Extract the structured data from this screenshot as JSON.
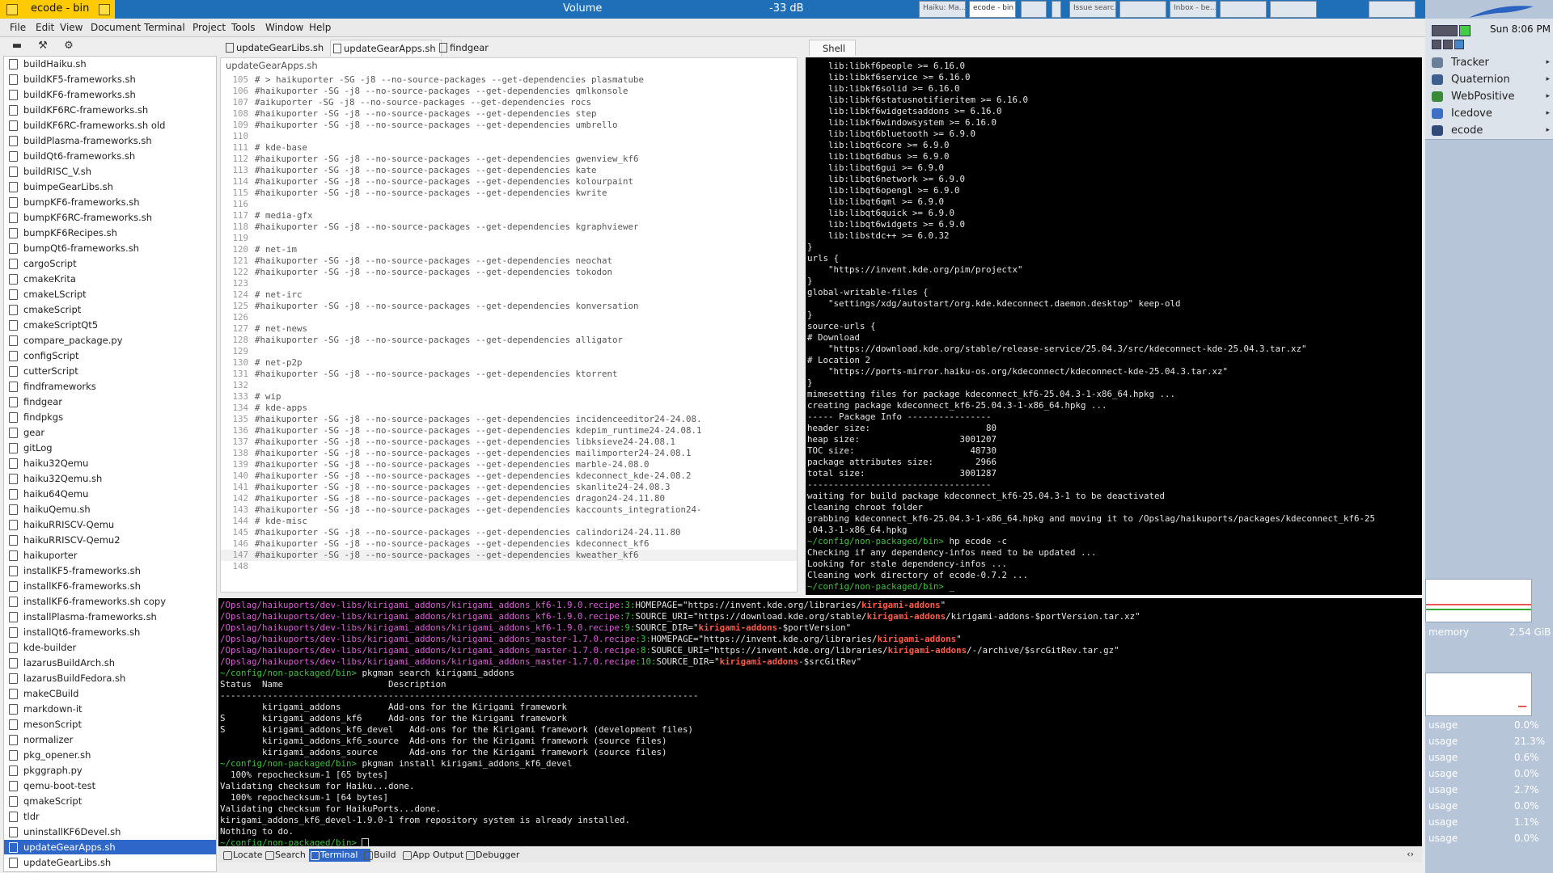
{
  "window": {
    "title": "ecode - bin"
  },
  "topbar": {
    "volume_label": "Volume",
    "volume_db": "-33 dB",
    "tasks": [
      "Haiku: Ma...",
      "ecode - bin",
      "",
      "",
      "Issue searc...",
      "",
      "Inbox - be...",
      "",
      "",
      ""
    ]
  },
  "menu": [
    "File",
    "Edit",
    "View",
    "Document",
    "Terminal",
    "Project",
    "Tools",
    "Window",
    "Help"
  ],
  "toolbar_icons": [
    "folder-icon",
    "wrench-icon",
    "gear-icon"
  ],
  "files": [
    "buildHaiku.sh",
    "buildKF5-frameworks.sh",
    "buildKF6-frameworks.sh",
    "buildKF6RC-frameworks.sh",
    "buildKF6RC-frameworks.sh old",
    "buildPlasma-frameworks.sh",
    "buildQt6-frameworks.sh",
    "buildRISC_V.sh",
    "buimpeGearLibs.sh",
    "bumpKF6-frameworks.sh",
    "bumpKF6RC-frameworks.sh",
    "bumpKF6Recipes.sh",
    "bumpQt6-frameworks.sh",
    "cargoScript",
    "cmakeKrita",
    "cmakeLScript",
    "cmakeScript",
    "cmakeScriptQt5",
    "compare_package.py",
    "configScript",
    "cutterScript",
    "findframeworks",
    "findgear",
    "findpkgs",
    "gear",
    "gitLog",
    "haiku32Qemu",
    "haiku32Qemu.sh",
    "haiku64Qemu",
    "haikuQemu.sh",
    "haikuRRISCV-Qemu",
    "haikuRRISCV-Qemu2",
    "haikuporter",
    "installKF5-frameworks.sh",
    "installKF6-frameworks.sh",
    "installKF6-frameworks.sh copy",
    "installPlasma-frameworks.sh",
    "installQt6-frameworks.sh",
    "kde-builder",
    "lazarusBuildArch.sh",
    "lazarusBuildFedora.sh",
    "makeCBuild",
    "markdown-it",
    "mesonScript",
    "normalizer",
    "pkg_opener.sh",
    "pkggraph.py",
    "qemu-boot-test",
    "qmakeScript",
    "tldr",
    "uninstallKF6Devel.sh",
    "updateGearApps.sh",
    "updateGearLibs.sh"
  ],
  "selected_file": "updateGearApps.sh",
  "editor": {
    "tabs": [
      "updateGearLibs.sh",
      "updateGearApps.sh",
      "findgear"
    ],
    "breadcrumb": "updateGearApps.sh",
    "lines": [
      [
        "105",
        "# > haikuporter -SG -j8 --no-source-packages --get-dependencies plasmatube"
      ],
      [
        "106",
        "#haikuporter -SG -j8 --no-source-packages --get-dependencies qmlkonsole"
      ],
      [
        "107",
        "#aikuporter -SG -j8 --no-source-packages --get-dependencies rocs"
      ],
      [
        "108",
        "#haikuporter -SG -j8 --no-source-packages --get-dependencies step"
      ],
      [
        "109",
        "#haikuporter -SG -j8 --no-source-packages --get-dependencies umbrello"
      ],
      [
        "110",
        ""
      ],
      [
        "111",
        "# kde-base"
      ],
      [
        "112",
        "#haikuporter -SG -j8 --no-source-packages --get-dependencies gwenview_kf6"
      ],
      [
        "113",
        "#haikuporter -SG -j8 --no-source-packages --get-dependencies kate"
      ],
      [
        "114",
        "#haikuporter -SG -j8 --no-source-packages --get-dependencies kolourpaint"
      ],
      [
        "115",
        "#haikuporter -SG -j8 --no-source-packages --get-dependencies kwrite"
      ],
      [
        "116",
        ""
      ],
      [
        "117",
        "# media-gfx"
      ],
      [
        "118",
        "#haikuporter -SG -j8 --no-source-packages --get-dependencies kgraphviewer"
      ],
      [
        "119",
        ""
      ],
      [
        "120",
        "# net-im"
      ],
      [
        "121",
        "#haikuporter -SG -j8 --no-source-packages --get-dependencies neochat"
      ],
      [
        "122",
        "#haikuporter -SG -j8 --no-source-packages --get-dependencies tokodon"
      ],
      [
        "123",
        ""
      ],
      [
        "124",
        "# net-irc"
      ],
      [
        "125",
        "#haikuporter -SG -j8 --no-source-packages --get-dependencies konversation"
      ],
      [
        "126",
        ""
      ],
      [
        "127",
        "# net-news"
      ],
      [
        "128",
        "#haikuporter -SG -j8 --no-source-packages --get-dependencies alligator"
      ],
      [
        "129",
        ""
      ],
      [
        "130",
        "# net-p2p"
      ],
      [
        "131",
        "#haikuporter -SG -j8 --no-source-packages --get-dependencies ktorrent"
      ],
      [
        "132",
        ""
      ],
      [
        "133",
        "# wip"
      ],
      [
        "134",
        "# kde-apps"
      ],
      [
        "135",
        "#haikuporter -SG -j8 --no-source-packages --get-dependencies incidenceeditor24-24.08."
      ],
      [
        "136",
        "#haikuporter -SG -j8 --no-source-packages --get-dependencies kdepim_runtime24-24.08.1"
      ],
      [
        "137",
        "#haikuporter -SG -j8 --no-source-packages --get-dependencies libksieve24-24.08.1"
      ],
      [
        "138",
        "#haikuporter -SG -j8 --no-source-packages --get-dependencies mailimporter24-24.08.1"
      ],
      [
        "139",
        "#haikuporter -SG -j8 --no-source-packages --get-dependencies marble-24.08.0"
      ],
      [
        "140",
        "#haikuporter -SG -j8 --no-source-packages --get-dependencies kdeconnect_kde-24.08.2"
      ],
      [
        "141",
        "#haikuporter -SG -j8 --no-source-packages --get-dependencies skanlite24-24.08.3"
      ],
      [
        "142",
        "#haikuporter -SG -j8 --no-source-packages --get-dependencies dragon24-24.11.80"
      ],
      [
        "143",
        "#haikuporter -SG -j8 --no-source-packages --get-dependencies kaccounts_integration24-"
      ],
      [
        "144",
        "# kde-misc"
      ],
      [
        "145",
        "#haikuporter -SG -j8 --no-source-packages --get-dependencies calindori24-24.11.80"
      ],
      [
        "146",
        "#haikuporter -SG -j8 --no-source-packages --get-dependencies kdeconnect_kf6"
      ],
      [
        "147",
        "#haikuporter -SG -j8 --no-source-packages --get-dependencies kweather_kf6"
      ],
      [
        "148",
        ""
      ]
    ]
  },
  "shell": {
    "tab": "Shell",
    "lines": [
      "    lib:libkf6people >= 6.16.0",
      "    lib:libkf6service >= 6.16.0",
      "    lib:libkf6solid >= 6.16.0",
      "    lib:libkf6statusnotifieritem >= 6.16.0",
      "    lib:libkf6widgetsaddons >= 6.16.0",
      "    lib:libkf6windowsystem >= 6.16.0",
      "    lib:libqt6bluetooth >= 6.9.0",
      "    lib:libqt6core >= 6.9.0",
      "    lib:libqt6dbus >= 6.9.0",
      "    lib:libqt6gui >= 6.9.0",
      "    lib:libqt6network >= 6.9.0",
      "    lib:libqt6opengl >= 6.9.0",
      "    lib:libqt6qml >= 6.9.0",
      "    lib:libqt6quick >= 6.9.0",
      "    lib:libqt6widgets >= 6.9.0",
      "    lib:libstdc++ >= 6.0.32",
      "}",
      "urls {",
      "    \"https://invent.kde.org/pim/projectx\"",
      "}",
      "global-writable-files {",
      "    \"settings/xdg/autostart/org.kde.kdeconnect.daemon.desktop\" keep-old",
      "}",
      "source-urls {",
      "# Download",
      "    \"https://download.kde.org/stable/release-service/25.04.3/src/kdeconnect-kde-25.04.3.tar.xz\"",
      "# Location 2",
      "    \"https://ports-mirror.haiku-os.org/kdeconnect/kdeconnect-kde-25.04.3.tar.xz\"",
      "}",
      "mimesetting files for package kdeconnect_kf6-25.04.3-1-x86_64.hpkg ...",
      "creating package kdeconnect_kf6-25.04.3-1-x86_64.hpkg ...",
      "----- Package Info ----------------",
      "header size:                      80",
      "heap size:                   3001207",
      "TOC size:                      48730",
      "package attributes size:        2966",
      "total size:                  3001287",
      "-----------------------------------",
      "waiting for build package kdeconnect_kf6-25.04.3-1 to be deactivated",
      "cleaning chroot folder",
      "grabbing kdeconnect_kf6-25.04.3-1-x86_64.hpkg and moving it to /Opslag/haikuports/packages/kdeconnect_kf6-25",
      ".04.3-1-x86_64.hpkg"
    ],
    "prompt1": "~/config/non-packaged/bin>",
    "cmd1": " hp ecode -c",
    "after": [
      "Checking if any dependency-infos need to be updated ...",
      "Looking for stale dependency-infos ...",
      "Cleaning work directory of ecode-0.7.2 ..."
    ],
    "prompt2": "~/config/non-packaged/bin>",
    "cursor": " _"
  },
  "terminal": {
    "grep": [
      {
        "path": "/Opslag/haikuports/dev-libs/kirigami_addons/kirigami_addons_kf6-1.9.0.recipe",
        "ln": ":3:",
        "pre": "HOMEPAGE=\"https://invent.kde.org/libraries/",
        "hit": "kirigami-addons",
        "post": "\""
      },
      {
        "path": "/Opslag/haikuports/dev-libs/kirigami_addons/kirigami_addons_kf6-1.9.0.recipe",
        "ln": ":7:",
        "pre": "SOURCE_URI=\"https://download.kde.org/stable/",
        "hit": "kirigami-addons",
        "post": "/kirigami-addons-$portVersion.tar.xz\""
      },
      {
        "path": "/Opslag/haikuports/dev-libs/kirigami_addons/kirigami_addons_kf6-1.9.0.recipe",
        "ln": ":9:",
        "pre": "SOURCE_DIR=\"",
        "hit": "kirigami-addons",
        "post": "-$portVersion\""
      },
      {
        "path": "/Opslag/haikuports/dev-libs/kirigami_addons/kirigami_addons_master-1.7.0.recipe",
        "ln": ":3:",
        "pre": "HOMEPAGE=\"https://invent.kde.org/libraries/",
        "hit": "kirigami-addons",
        "post": "\""
      },
      {
        "path": "/Opslag/haikuports/dev-libs/kirigami_addons/kirigami_addons_master-1.7.0.recipe",
        "ln": ":8:",
        "pre": "SOURCE_URI=\"https://invent.kde.org/libraries/",
        "hit": "kirigami-addons",
        "post": "/-/archive/$srcGitRev.tar.gz\""
      },
      {
        "path": "/Opslag/haikuports/dev-libs/kirigami_addons/kirigami_addons_master-1.7.0.recipe",
        "ln": ":10:",
        "pre": "SOURCE_DIR=\"",
        "hit": "kirigami-addons",
        "post": "-$srcGitRev\""
      }
    ],
    "prompt": "~/config/non-packaged/bin>",
    "cmd_search": " pkgman search kirigami_addons",
    "header": "Status  Name                    Description",
    "divider": "-------------------------------------------------------------------------------------------",
    "rows": [
      "        kirigami_addons         Add-ons for the Kirigami framework",
      "S       kirigami_addons_kf6     Add-ons for the Kirigami framework",
      "S       kirigami_addons_kf6_devel   Add-ons for the Kirigami framework (development files)",
      "        kirigami_addons_kf6_source  Add-ons for the Kirigami framework (source files)",
      "        kirigami_addons_source      Add-ons for the Kirigami framework (source files)"
    ],
    "cmd_install": " pkgman install kirigami_addons_kf6_devel",
    "install_out": [
      "  100% repochecksum-1 [65 bytes]",
      "Validating checksum for Haiku...done.",
      "  100% repochecksum-1 [64 bytes]",
      "Validating checksum for HaikuPorts...done.",
      "kirigami_addons_kf6_devel-1.9.0-1 from repository system is already installed.",
      "Nothing to do."
    ]
  },
  "bottom_tabs": [
    "Locate",
    "Search",
    "Terminal",
    "Build",
    "App Output",
    "Debugger"
  ],
  "deskbar": {
    "clock": "Sun 8:06 PM",
    "items": [
      {
        "label": "Tracker",
        "color": "#6a7f99"
      },
      {
        "label": "Quaternion",
        "color": "#3d5f8f"
      },
      {
        "label": "WebPositive",
        "color": "#3a8a3a"
      },
      {
        "label": "Icedove",
        "color": "#3b6fc4"
      },
      {
        "label": "ecode",
        "color": "#2f4a78"
      }
    ],
    "memory_label": "memory",
    "memory_value": "2.54 GiB",
    "usage": [
      {
        "label": "usage",
        "value": "0.0%"
      },
      {
        "label": "usage",
        "value": "21.3%"
      },
      {
        "label": "usage",
        "value": "0.6%"
      },
      {
        "label": "usage",
        "value": "0.0%"
      },
      {
        "label": "usage",
        "value": "2.7%"
      },
      {
        "label": "usage",
        "value": "0.0%"
      },
      {
        "label": "usage",
        "value": "1.1%"
      },
      {
        "label": "usage",
        "value": "0.0%"
      }
    ]
  }
}
